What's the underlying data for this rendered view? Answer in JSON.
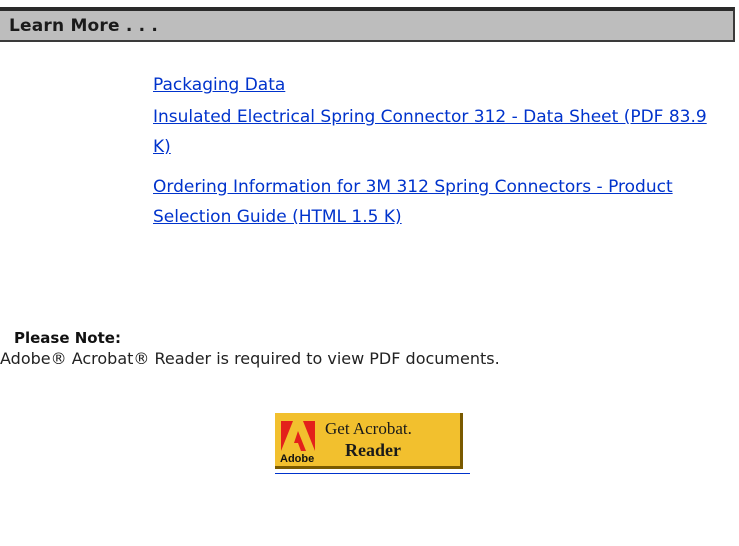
{
  "header": {
    "title": "Learn More . . ."
  },
  "links": [
    {
      "label": "Packaging Data"
    },
    {
      "label": "Insulated Electrical Spring Connector 312 - Data Sheet (PDF 83.9 K)"
    },
    {
      "label": "Ordering Information for 3M 312 Spring Connectors - Product Selection Guide (HTML 1.5 K)"
    }
  ],
  "note": {
    "title": "Please Note:",
    "text": "Adobe® Acrobat® Reader is required to view PDF documents."
  },
  "acrobat_badge": {
    "brand": "Adobe",
    "line1": "Get Acrobat.",
    "line2": "Reader",
    "background": "#f2c02e",
    "logo_color": "#e3201b",
    "icon": "adobe-logo-icon"
  },
  "colors": {
    "link": "#0033cc",
    "header_bg": "#bdbdbd"
  }
}
